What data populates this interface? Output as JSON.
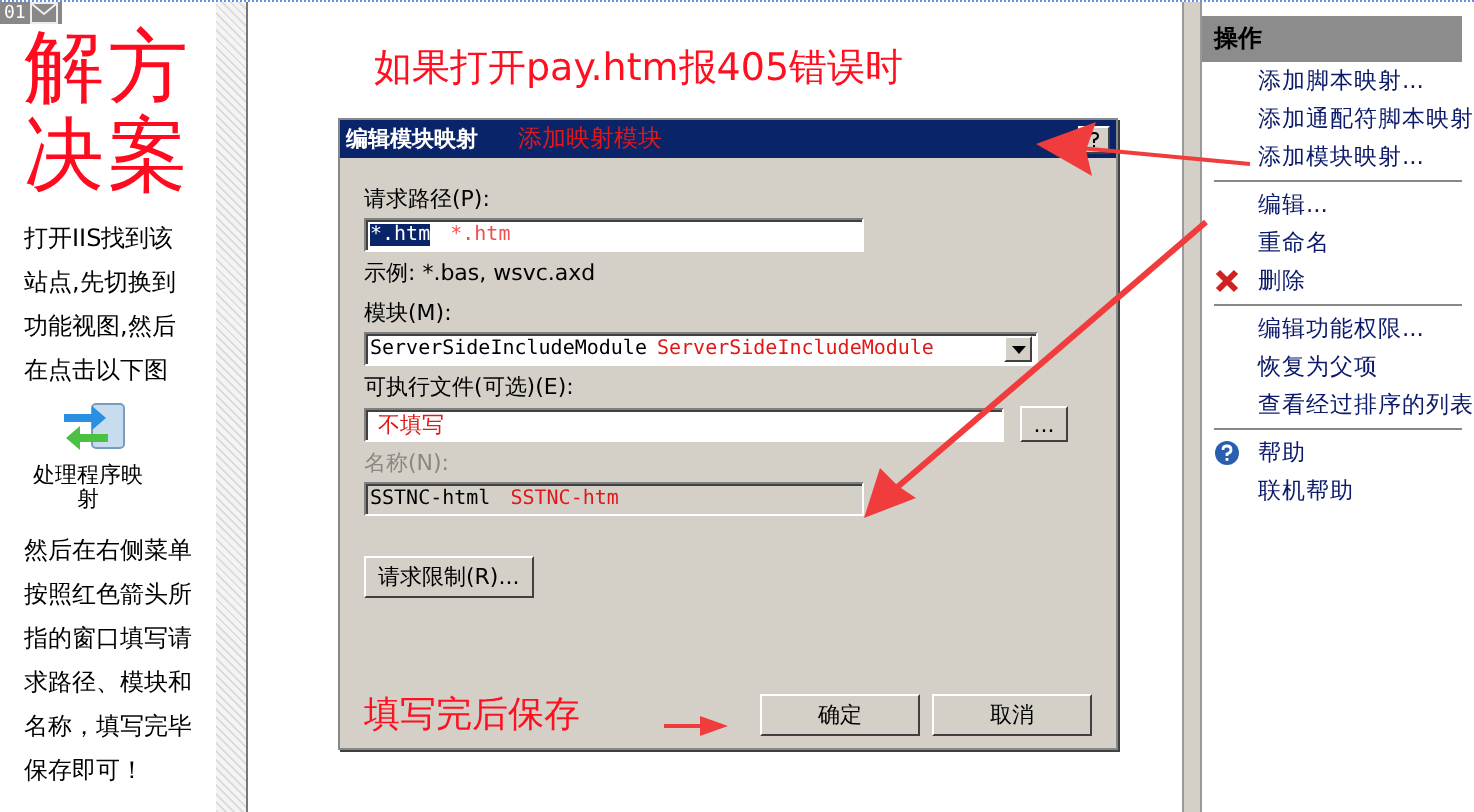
{
  "badge": {
    "number": "01"
  },
  "left_panel": {
    "title_columns": [
      "解决",
      "方案"
    ],
    "intro": "打开IIS找到该站点,先切换到功能视图,然后在点击以下图",
    "feature_label": "处理程序映射",
    "outro": "然后在右侧菜单按照红色箭头所指的窗口填写请求路径、模块和名称，填写完毕保存即可！"
  },
  "heading": "如果打开pay.htm报405错误时",
  "dialog": {
    "title": "编辑模块映射",
    "note": "添加映射模块",
    "request_path": {
      "label": "请求路径(P):",
      "value": "*.htm",
      "selected": true,
      "note": "*.htm"
    },
    "example": "示例: *.bas, wsvc.axd",
    "module": {
      "label": "模块(M):",
      "value": "ServerSideIncludeModule",
      "note": "ServerSideIncludeModule"
    },
    "executable": {
      "label": "可执行文件(可选)(E):",
      "note": "不填写",
      "browse": "..."
    },
    "name": {
      "label": "名称(N):",
      "disabled": true,
      "value": "SSTNC-html",
      "note": "SSTNC-htm"
    },
    "restrictions_button": "请求限制(R)...",
    "ok_button": "确定",
    "cancel_button": "取消"
  },
  "save_note": "填写完后保存",
  "actions": {
    "title": "操作",
    "groups": [
      [
        {
          "label": "添加脚本映射...",
          "kind": "link"
        },
        {
          "label": "添加通配符脚本映射",
          "kind": "link"
        },
        {
          "label": "添加模块映射...",
          "kind": "link"
        }
      ],
      [
        {
          "label": "编辑...",
          "kind": "link"
        },
        {
          "label": "重命名",
          "kind": "link"
        },
        {
          "label": "删除",
          "kind": "delete"
        }
      ],
      [
        {
          "label": "编辑功能权限...",
          "kind": "link"
        },
        {
          "label": "恢复为父项",
          "kind": "link"
        },
        {
          "label": "查看经过排序的列表",
          "kind": "link"
        }
      ],
      [
        {
          "label": "帮助",
          "kind": "help"
        },
        {
          "label": "联机帮助",
          "kind": "link"
        }
      ]
    ]
  }
}
